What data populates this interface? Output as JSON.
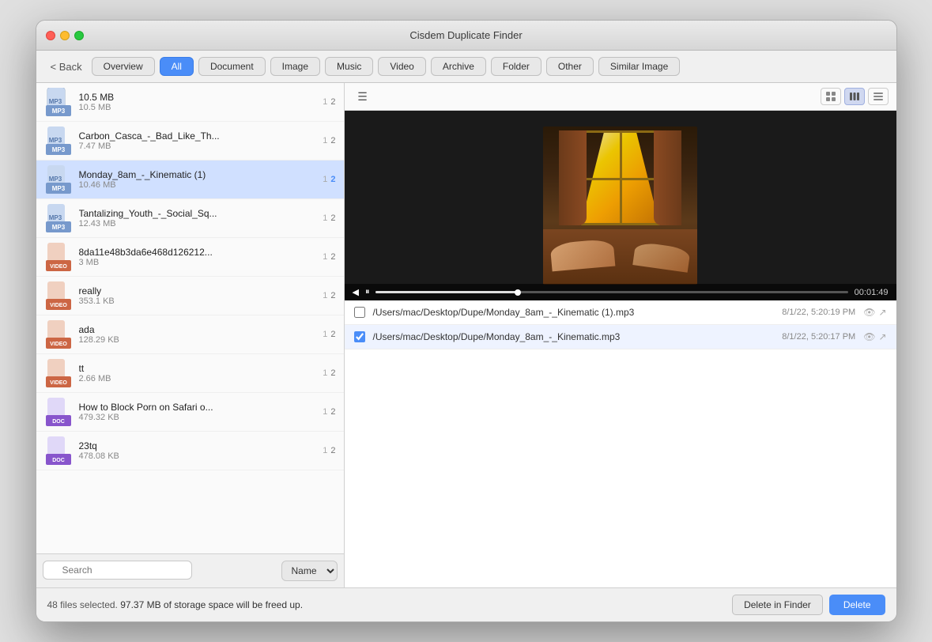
{
  "window": {
    "title": "Cisdem Duplicate Finder"
  },
  "toolbar": {
    "back_label": "< Back",
    "tabs": [
      {
        "id": "overview",
        "label": "Overview",
        "active": false
      },
      {
        "id": "all",
        "label": "All",
        "active": true
      },
      {
        "id": "document",
        "label": "Document",
        "active": false
      },
      {
        "id": "image",
        "label": "Image",
        "active": false
      },
      {
        "id": "music",
        "label": "Music",
        "active": false
      },
      {
        "id": "video",
        "label": "Video",
        "active": false
      },
      {
        "id": "archive",
        "label": "Archive",
        "active": false
      },
      {
        "id": "folder",
        "label": "Folder",
        "active": false
      },
      {
        "id": "other",
        "label": "Other",
        "active": false
      },
      {
        "id": "similar-image",
        "label": "Similar Image",
        "active": false
      }
    ]
  },
  "file_list": {
    "items": [
      {
        "name": "10.5 MB",
        "title": "10.5 MB",
        "size": "10.5 MB",
        "count1": "1",
        "count2": "2",
        "icon": "🎵",
        "selected": false
      },
      {
        "name": "Carbon_Casca_-_Bad_Like_Th...",
        "title": "Carbon_Casca_-_Bad_Like_Th...",
        "size": "7.47 MB",
        "count1": "1",
        "count2": "2",
        "icon": "🎵",
        "selected": false
      },
      {
        "name": "Monday_8am_-_Kinematic (1)",
        "title": "Monday_8am_-_Kinematic (1)",
        "size": "10.46 MB",
        "count1": "1",
        "count2": "2",
        "icon": "🎵",
        "selected": true
      },
      {
        "name": "Tantalizing_Youth_-_Social_Sq...",
        "title": "Tantalizing_Youth_-_Social_Sq...",
        "size": "12.43 MB",
        "count1": "1",
        "count2": "2",
        "icon": "🎵",
        "selected": false
      },
      {
        "name": "8da11e48b3da6e468d126212...",
        "title": "8da11e48b3da6e468d126212...",
        "size": "3 MB",
        "count1": "1",
        "count2": "2",
        "icon": "📹",
        "selected": false
      },
      {
        "name": "really",
        "title": "really",
        "size": "353.1 KB",
        "count1": "1",
        "count2": "2",
        "icon": "📹",
        "selected": false
      },
      {
        "name": "ada",
        "title": "ada",
        "size": "128.29 KB",
        "count1": "1",
        "count2": "2",
        "icon": "📹",
        "selected": false
      },
      {
        "name": "tt",
        "title": "tt",
        "size": "2.66 MB",
        "count1": "1",
        "count2": "2",
        "icon": "📹",
        "selected": false
      },
      {
        "name": "How to Block Porn on Safari o...",
        "title": "How to Block Porn on Safari o...",
        "size": "479.32 KB",
        "count1": "1",
        "count2": "2",
        "icon": "📄",
        "selected": false
      },
      {
        "name": "23tq",
        "title": "23tq",
        "size": "478.08 KB",
        "count1": "1",
        "count2": "2",
        "icon": "📄",
        "selected": false
      }
    ],
    "search_placeholder": "Search",
    "sort_label": "Name"
  },
  "right_panel": {
    "view_buttons": [
      {
        "id": "grid",
        "icon": "⊞",
        "active": false
      },
      {
        "id": "filmstrip",
        "icon": "▦",
        "active": true
      },
      {
        "id": "list",
        "icon": "☰",
        "active": false
      }
    ],
    "media_time": "00:01:49",
    "file_entries": [
      {
        "path": "/Users/mac/Desktop/Dupe/Monday_8am_-_Kinematic (1).mp3",
        "date": "8/1/22, 5:20:19 PM",
        "checked": false,
        "highlighted": false
      },
      {
        "path": "/Users/mac/Desktop/Dupe/Monday_8am_-_Kinematic.mp3",
        "date": "8/1/22, 5:20:17 PM",
        "checked": true,
        "highlighted": true
      }
    ]
  },
  "statusbar": {
    "text": "48 files selected.",
    "storage_text": "97.37 MB of storage space will be freed up.",
    "delete_finder_label": "Delete in Finder",
    "delete_label": "Delete"
  }
}
